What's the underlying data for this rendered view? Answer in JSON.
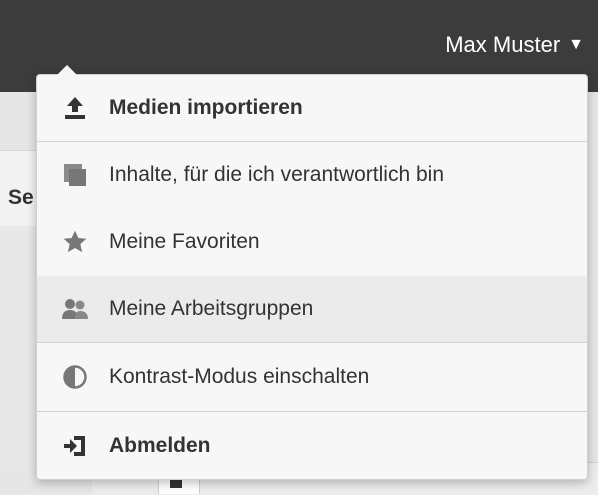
{
  "header": {
    "user_name": "Max Muster",
    "caret": "▼"
  },
  "background": {
    "partial_label": "Se"
  },
  "menu": {
    "import_media": "Medien importieren",
    "responsible_content": "Inhalte, für die ich verantwortlich bin",
    "favorites": "Meine Favoriten",
    "workgroups": "Meine Arbeitsgruppen",
    "contrast_mode": "Kontrast-Modus einschalten",
    "logout": "Abmelden"
  },
  "colors": {
    "topbar": "#3c3c3c",
    "menu_bg": "#f7f7f7",
    "hover_bg": "#ebebeb",
    "icon": "#777777",
    "text": "#333333"
  }
}
